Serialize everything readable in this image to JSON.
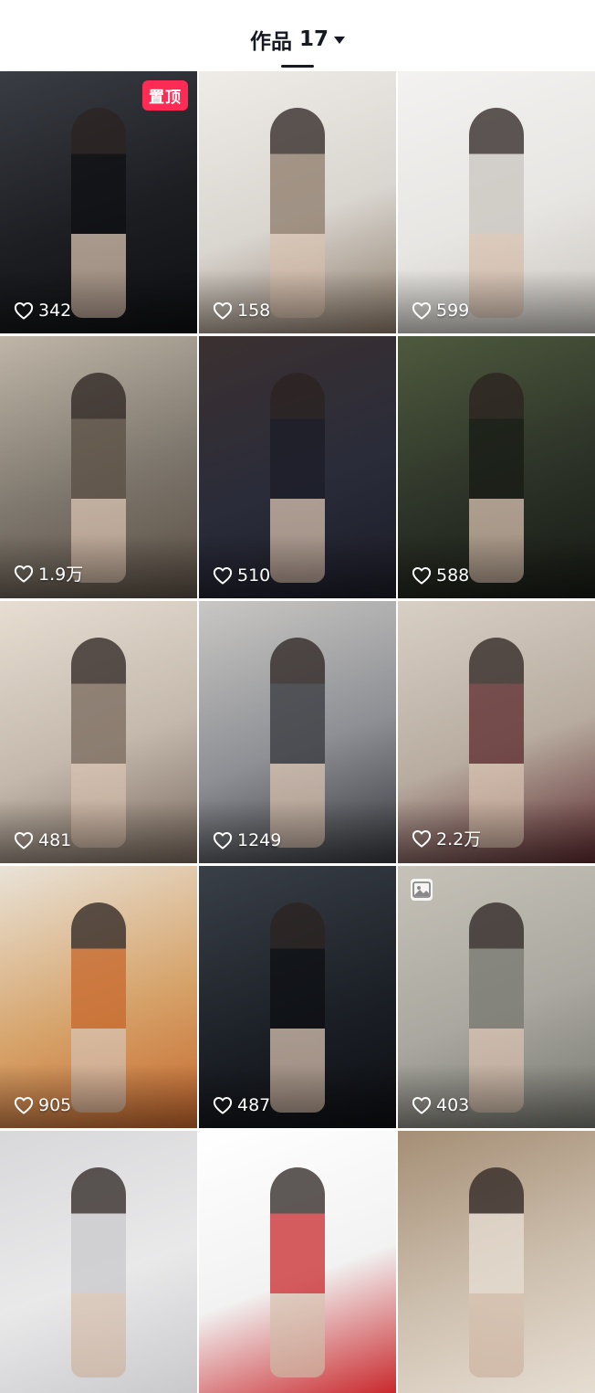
{
  "header": {
    "tab_label": "作品",
    "tab_count": "17"
  },
  "badges": {
    "pinned": "置顶"
  },
  "posts": [
    {
      "likes": "342",
      "pinned": true,
      "colors": [
        "#1c1e22",
        "#3a3d44",
        "#0e0f12"
      ]
    },
    {
      "likes": "158",
      "colors": [
        "#d9d5cf",
        "#efece8",
        "#8d7b6a"
      ]
    },
    {
      "likes": "599",
      "colors": [
        "#e8e6e3",
        "#f3f2f0",
        "#c9c5bf"
      ]
    },
    {
      "likes": "1.9万",
      "colors": [
        "#7d766c",
        "#bfb6a8",
        "#5a4e43"
      ]
    },
    {
      "likes": "510",
      "colors": [
        "#2a2c3a",
        "#3b3030",
        "#1b1c27"
      ]
    },
    {
      "likes": "588",
      "colors": [
        "#2d3328",
        "#4e5a3e",
        "#161a14"
      ]
    },
    {
      "likes": "481",
      "colors": [
        "#c4b8ac",
        "#e7ddd2",
        "#7a6a5e"
      ]
    },
    {
      "likes": "1249",
      "colors": [
        "#8d8f94",
        "#c9c7c4",
        "#36383d"
      ]
    },
    {
      "likes": "2.2万",
      "colors": [
        "#b8aca0",
        "#d8cfc5",
        "#5c2a2e"
      ]
    },
    {
      "likes": "905",
      "colors": [
        "#d6a36a",
        "#e9e3d8",
        "#c7672c"
      ]
    },
    {
      "likes": "487",
      "colors": [
        "#1d2128",
        "#3a4048",
        "#0c0e12"
      ]
    },
    {
      "likes": "403",
      "image_post": true,
      "colors": [
        "#a9a79f",
        "#c6c2b8",
        "#777770"
      ]
    },
    {
      "likes": "",
      "colors": [
        "#e9e9ea",
        "#d8d8da",
        "#c9c9cc"
      ]
    },
    {
      "likes": "",
      "colors": [
        "#f2f2f2",
        "#ffffff",
        "#c9292d"
      ]
    },
    {
      "likes": "",
      "colors": [
        "#cdbfae",
        "#a58e75",
        "#e6ddd2"
      ]
    }
  ]
}
